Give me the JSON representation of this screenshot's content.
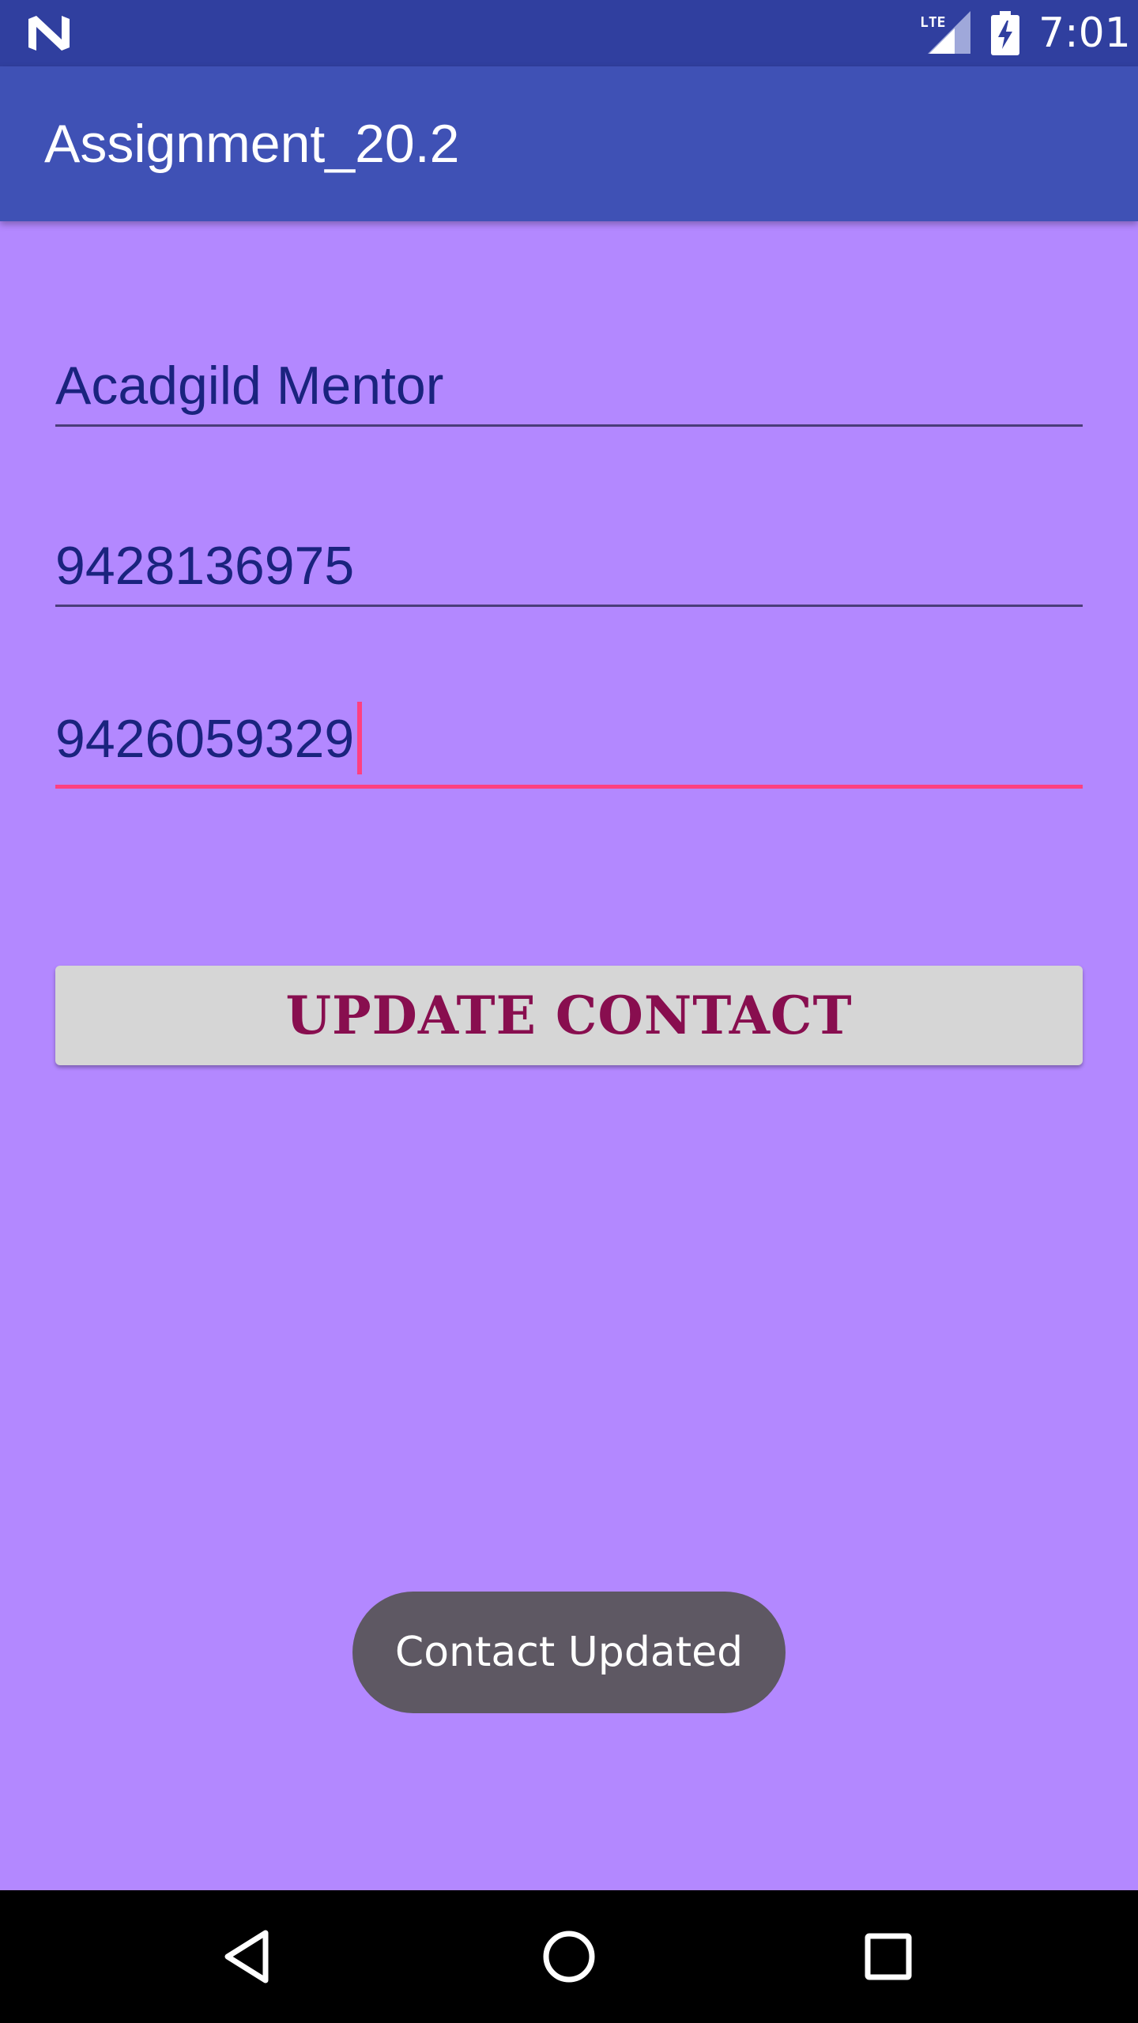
{
  "status_bar": {
    "time": "7:01",
    "network_label": "LTE",
    "icons": [
      "n-logo-icon",
      "lte-signal-icon",
      "battery-charging-icon"
    ]
  },
  "app_bar": {
    "title": "Assignment_20.2"
  },
  "form": {
    "name_value": "Acadgild Mentor",
    "phone1_value": "9428136975",
    "phone2_value": "9426059329",
    "update_button_label": "UPDATE CONTACT"
  },
  "toast": {
    "message": "Contact Updated"
  },
  "nav_bar": {
    "icons": [
      "back-icon",
      "home-icon",
      "recents-icon"
    ]
  },
  "colors": {
    "status_bar": "#303f9f",
    "app_bar": "#3f51b5",
    "background": "#b388ff",
    "accent": "#ff4081",
    "input_text": "#1a237e",
    "button_text": "#880e4f",
    "toast_bg": "#5e5863"
  }
}
